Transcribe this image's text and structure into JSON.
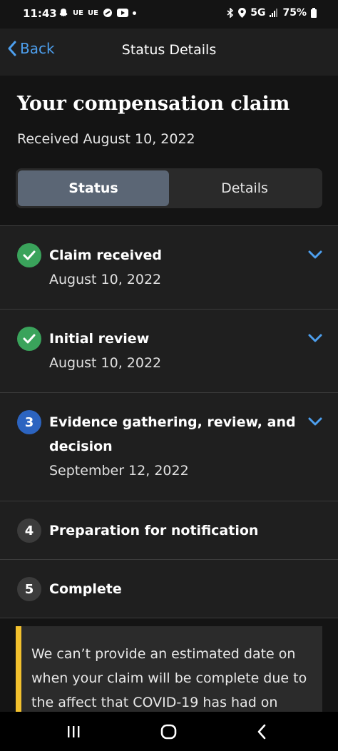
{
  "status_bar": {
    "time": "11:43",
    "left_icons": [
      "snapchat-icon",
      "ue-text-1",
      "ue-text-2",
      "link-icon",
      "youtube-icon",
      "dot"
    ],
    "ue1": "UE",
    "ue2": "UE",
    "network": "5G",
    "battery": "75%"
  },
  "nav": {
    "back_label": "Back",
    "title": "Status Details"
  },
  "claim": {
    "title": "Your compensation claim",
    "received": "Received August 10, 2022",
    "tabs": [
      {
        "label": "Status",
        "active": true
      },
      {
        "label": "Details",
        "active": false
      }
    ]
  },
  "steps": [
    {
      "marker": "",
      "status": "done",
      "title": "Claim received",
      "date": "August 10, 2022",
      "expandable": true
    },
    {
      "marker": "",
      "status": "done",
      "title": "Initial review",
      "date": "August 10, 2022",
      "expandable": true
    },
    {
      "marker": "3",
      "status": "current",
      "title": "Evidence gathering, review, and decision",
      "date": "September 12, 2022",
      "expandable": true
    },
    {
      "marker": "4",
      "status": "pending",
      "title": "Preparation for notification",
      "date": "",
      "expandable": false
    },
    {
      "marker": "5",
      "status": "pending",
      "title": "Complete",
      "date": "",
      "expandable": false
    }
  ],
  "info": {
    "text": "We can’t provide an estimated date on when your claim will be complete due to the affect that COVID-19 has had on"
  },
  "colors": {
    "accent": "#4d9fee",
    "done": "#3aa35b",
    "current": "#2c64c0",
    "warning": "#f2c12e"
  }
}
